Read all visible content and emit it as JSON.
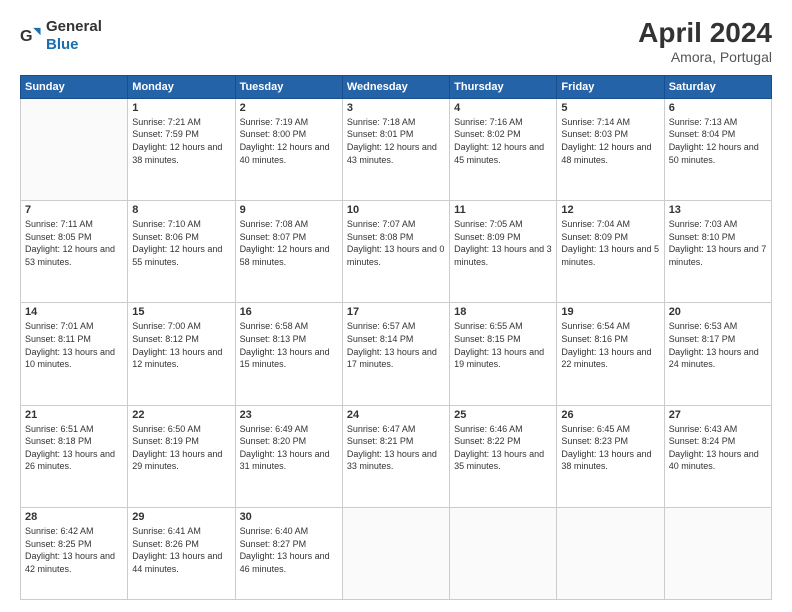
{
  "logo": {
    "general": "General",
    "blue": "Blue"
  },
  "header": {
    "month_year": "April 2024",
    "location": "Amora, Portugal"
  },
  "weekdays": [
    "Sunday",
    "Monday",
    "Tuesday",
    "Wednesday",
    "Thursday",
    "Friday",
    "Saturday"
  ],
  "weeks": [
    [
      null,
      {
        "day": 1,
        "sunrise": "7:21 AM",
        "sunset": "7:59 PM",
        "daylight": "12 hours and 38 minutes."
      },
      {
        "day": 2,
        "sunrise": "7:19 AM",
        "sunset": "8:00 PM",
        "daylight": "12 hours and 40 minutes."
      },
      {
        "day": 3,
        "sunrise": "7:18 AM",
        "sunset": "8:01 PM",
        "daylight": "12 hours and 43 minutes."
      },
      {
        "day": 4,
        "sunrise": "7:16 AM",
        "sunset": "8:02 PM",
        "daylight": "12 hours and 45 minutes."
      },
      {
        "day": 5,
        "sunrise": "7:14 AM",
        "sunset": "8:03 PM",
        "daylight": "12 hours and 48 minutes."
      },
      {
        "day": 6,
        "sunrise": "7:13 AM",
        "sunset": "8:04 PM",
        "daylight": "12 hours and 50 minutes."
      }
    ],
    [
      {
        "day": 7,
        "sunrise": "7:11 AM",
        "sunset": "8:05 PM",
        "daylight": "12 hours and 53 minutes."
      },
      {
        "day": 8,
        "sunrise": "7:10 AM",
        "sunset": "8:06 PM",
        "daylight": "12 hours and 55 minutes."
      },
      {
        "day": 9,
        "sunrise": "7:08 AM",
        "sunset": "8:07 PM",
        "daylight": "12 hours and 58 minutes."
      },
      {
        "day": 10,
        "sunrise": "7:07 AM",
        "sunset": "8:08 PM",
        "daylight": "13 hours and 0 minutes."
      },
      {
        "day": 11,
        "sunrise": "7:05 AM",
        "sunset": "8:09 PM",
        "daylight": "13 hours and 3 minutes."
      },
      {
        "day": 12,
        "sunrise": "7:04 AM",
        "sunset": "8:09 PM",
        "daylight": "13 hours and 5 minutes."
      },
      {
        "day": 13,
        "sunrise": "7:03 AM",
        "sunset": "8:10 PM",
        "daylight": "13 hours and 7 minutes."
      }
    ],
    [
      {
        "day": 14,
        "sunrise": "7:01 AM",
        "sunset": "8:11 PM",
        "daylight": "13 hours and 10 minutes."
      },
      {
        "day": 15,
        "sunrise": "7:00 AM",
        "sunset": "8:12 PM",
        "daylight": "13 hours and 12 minutes."
      },
      {
        "day": 16,
        "sunrise": "6:58 AM",
        "sunset": "8:13 PM",
        "daylight": "13 hours and 15 minutes."
      },
      {
        "day": 17,
        "sunrise": "6:57 AM",
        "sunset": "8:14 PM",
        "daylight": "13 hours and 17 minutes."
      },
      {
        "day": 18,
        "sunrise": "6:55 AM",
        "sunset": "8:15 PM",
        "daylight": "13 hours and 19 minutes."
      },
      {
        "day": 19,
        "sunrise": "6:54 AM",
        "sunset": "8:16 PM",
        "daylight": "13 hours and 22 minutes."
      },
      {
        "day": 20,
        "sunrise": "6:53 AM",
        "sunset": "8:17 PM",
        "daylight": "13 hours and 24 minutes."
      }
    ],
    [
      {
        "day": 21,
        "sunrise": "6:51 AM",
        "sunset": "8:18 PM",
        "daylight": "13 hours and 26 minutes."
      },
      {
        "day": 22,
        "sunrise": "6:50 AM",
        "sunset": "8:19 PM",
        "daylight": "13 hours and 29 minutes."
      },
      {
        "day": 23,
        "sunrise": "6:49 AM",
        "sunset": "8:20 PM",
        "daylight": "13 hours and 31 minutes."
      },
      {
        "day": 24,
        "sunrise": "6:47 AM",
        "sunset": "8:21 PM",
        "daylight": "13 hours and 33 minutes."
      },
      {
        "day": 25,
        "sunrise": "6:46 AM",
        "sunset": "8:22 PM",
        "daylight": "13 hours and 35 minutes."
      },
      {
        "day": 26,
        "sunrise": "6:45 AM",
        "sunset": "8:23 PM",
        "daylight": "13 hours and 38 minutes."
      },
      {
        "day": 27,
        "sunrise": "6:43 AM",
        "sunset": "8:24 PM",
        "daylight": "13 hours and 40 minutes."
      }
    ],
    [
      {
        "day": 28,
        "sunrise": "6:42 AM",
        "sunset": "8:25 PM",
        "daylight": "13 hours and 42 minutes."
      },
      {
        "day": 29,
        "sunrise": "6:41 AM",
        "sunset": "8:26 PM",
        "daylight": "13 hours and 44 minutes."
      },
      {
        "day": 30,
        "sunrise": "6:40 AM",
        "sunset": "8:27 PM",
        "daylight": "13 hours and 46 minutes."
      },
      null,
      null,
      null,
      null
    ]
  ]
}
